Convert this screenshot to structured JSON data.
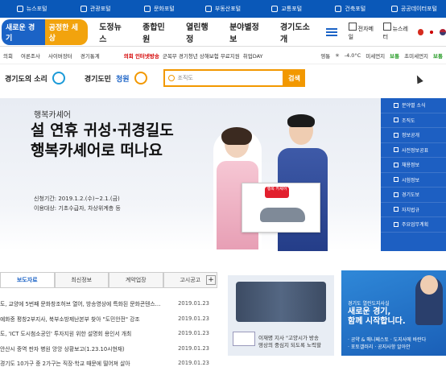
{
  "topbar": [
    {
      "label": "뉴스포털",
      "icon": "news-icon"
    },
    {
      "label": "관광포털",
      "icon": "map-pin-icon"
    },
    {
      "label": "문화포털",
      "icon": "culture-icon"
    },
    {
      "label": "부동산포털",
      "icon": "building-icon"
    },
    {
      "label": "교통포털",
      "icon": "car-icon"
    },
    {
      "label": "건축포털",
      "icon": "house-icon"
    },
    {
      "label": "공공데이터포털",
      "icon": "data-icon"
    }
  ],
  "logo": {
    "part1": "새로운 경기",
    "part2": "공정한 세상"
  },
  "gnb": [
    "도정뉴스",
    "종합민원",
    "열린행정",
    "분야별정보",
    "경기도소개"
  ],
  "header_right": {
    "mail": "전자메일",
    "newsletter": "뉴스레터"
  },
  "subbar": {
    "links": [
      "의회",
      "여론조사",
      "사이버장터",
      "경기통계"
    ],
    "notice_label": "의회 인터넷방송",
    "notice_text": "군복무 경기청년 상해보험 무료지원",
    "notice_extra": "취업DAY",
    "weather_loc": "영통",
    "temp": "-4.0°C",
    "dust_label": "미세먼지",
    "dust_status": "보통",
    "ultra_label": "초미세먼지",
    "ultra_status": "보통"
  },
  "search": {
    "voice": "경기도의 소리",
    "petition_prefix": "경기도민",
    "petition": "청원",
    "placeholder": "조직도",
    "button": "검색"
  },
  "banner": {
    "subtitle": "행복카셰어",
    "title1": "설 연휴 귀성·귀경길도",
    "title2": "행복카셰어로 떠나요",
    "date": "신청기간: 2019.1.2.(수)~2.1.(금)",
    "target": "이용대상: 기초수급자, 차상위계층 등",
    "sign": "행복 카셰어"
  },
  "side_menu": [
    "분야별 소식",
    "조직도",
    "정보공개",
    "사전정보공표",
    "채용정보",
    "시험정보",
    "경기도보",
    "자치법규",
    "주요업무계획"
  ],
  "tabs": [
    "보도자료",
    "최신정보",
    "계약업장",
    "고시공고"
  ],
  "news": [
    {
      "title": "도, 교양에 5번째 문화창조허브 열어, 방송영상에 특화된 문화콘텐스…",
      "date": "2019.01.23"
    },
    {
      "title": "예화중 평창2부지사, 북부소방제난본부 찾아 \"도민안전\" 강조",
      "date": "2019.01.23"
    },
    {
      "title": "도, 'ICT 도시첨소공인' 투자지원 위한 설명회 용인서 개최",
      "date": "2019.01.23"
    },
    {
      "title": "안산시 중역 판자 병원 앙앙 상황보고(1.23.10시현재)",
      "date": "2019.01.23"
    },
    {
      "title": "경기도 10가구 중 2가구는 직장·학교 때문에 떨어져 살아",
      "date": "2019.01.23"
    }
  ],
  "photo": {
    "caption1": "이재명 지사 \"고양시가 방송",
    "caption2": "영상의 중심지 되도록 노력할"
  },
  "promo": {
    "small": "경기도 열린도지사실",
    "title1": "새로운 경기,",
    "title2": "함께 시작합니다.",
    "foot1": "· 공약 & 매니페스토 · 도지사에 바란다",
    "foot2": "· 포토갤러리 · 공지사항 알아안"
  }
}
